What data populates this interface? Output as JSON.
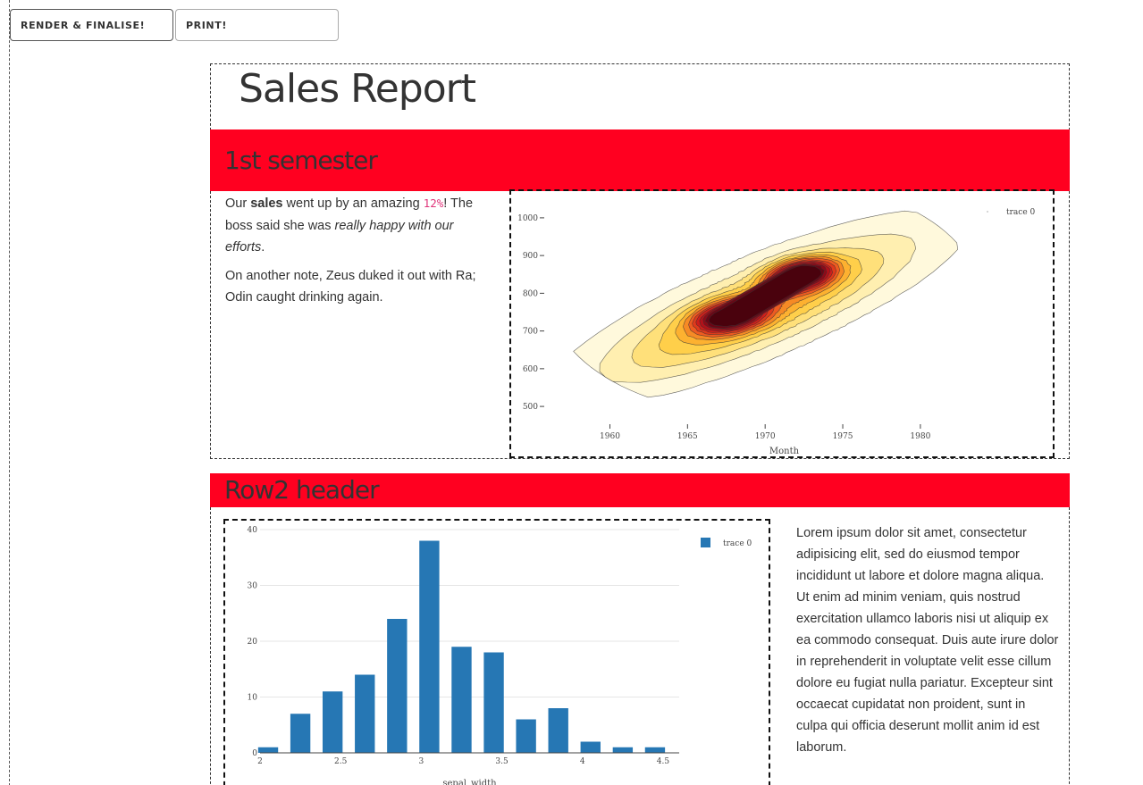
{
  "toolbar": {
    "render_label": "RENDER & FINALISE!",
    "print_label": "PRINT!"
  },
  "report": {
    "title": "Sales Report",
    "section1": {
      "header": "1st semester",
      "p1": {
        "t1": "Our ",
        "bold": "sales",
        "t2": " went up by an amazing ",
        "code": "12%",
        "t3": "! The boss said she was ",
        "italic": "really happy with our efforts",
        "t4": "."
      },
      "p2": "On another note, Zeus duked it out with Ra; Odin caught drinking again."
    },
    "section2": {
      "header": "Row2 header",
      "lorem": "Lorem ipsum dolor sit amet, consectetur adipisicing elit, sed do eiusmod tempor incididunt ut labore et dolore magna aliqua. Ut enim ad minim veniam, quis nostrud exercitation ullamco laboris nisi ut aliquip ex ea commodo consequat. Duis aute irure dolor in reprehenderit in voluptate velit esse cillum dolore eu fugiat nulla pariatur. Excepteur sint occaecat cupidatat non proident, sunt in culpa qui officia deserunt mollit anim id est laborum."
    }
  },
  "chart_data": [
    {
      "type": "heatmap",
      "subtype": "2d-density-contour",
      "title": "",
      "xlabel": "Month",
      "ylabel": "",
      "x_ticks": [
        1960,
        1965,
        1970,
        1975,
        1980
      ],
      "y_ticks": [
        500,
        600,
        700,
        800,
        900,
        1000
      ],
      "xlim": [
        1956,
        1983
      ],
      "ylim": [
        460,
        1040
      ],
      "series": [
        {
          "name": "trace 0"
        }
      ],
      "peaks": [
        {
          "x": 1972.3,
          "y": 850
        },
        {
          "x": 1967.7,
          "y": 738
        }
      ],
      "colorscale": [
        "#fff9dc",
        "#ffefb0",
        "#ffe07a",
        "#ffcf4a",
        "#fdb130",
        "#f68a25",
        "#ee5b21",
        "#e03a1c",
        "#cf1f1b",
        "#b0121a",
        "#8e0a18",
        "#6c0514",
        "#4a020d"
      ],
      "legend": "top-right",
      "grid": false
    },
    {
      "type": "bar",
      "title": "",
      "xlabel": "sepal_width",
      "ylabel": "",
      "x": [
        2.05,
        2.25,
        2.45,
        2.65,
        2.85,
        3.05,
        3.25,
        3.45,
        3.65,
        3.85,
        4.05,
        4.25,
        4.45
      ],
      "values": [
        1,
        7,
        11,
        14,
        24,
        38,
        19,
        18,
        6,
        8,
        2,
        1,
        1
      ],
      "bin_width": 0.2,
      "x_ticks": [
        "2",
        "2.5",
        "3",
        "3.5",
        "4",
        "4.5"
      ],
      "y_ticks": [
        "0",
        "10",
        "20",
        "30",
        "40"
      ],
      "xlim": [
        2,
        4.6
      ],
      "ylim": [
        0,
        40
      ],
      "series": [
        {
          "name": "trace 0"
        }
      ],
      "color": "#2677b4",
      "legend": "top-right",
      "grid": true
    }
  ]
}
